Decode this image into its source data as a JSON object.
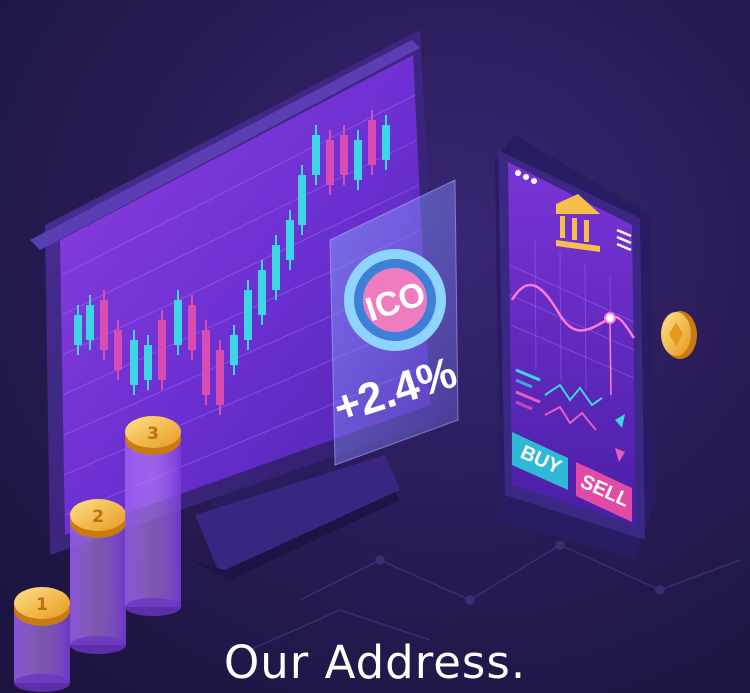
{
  "illustration": {
    "ico_badge": {
      "label": "ICO",
      "change": "+2.4%"
    },
    "phone": {
      "buy_label": "BUY",
      "sell_label": "SELL"
    },
    "coins": [
      "1",
      "2",
      "3"
    ]
  },
  "caption": {
    "text": "Our Address."
  },
  "colors": {
    "background": "#24184a",
    "screen": "#6a2fd0",
    "candle_cyan": "#3ed6e6",
    "candle_pink": "#d94cb3",
    "coin_gold": "#f5b942",
    "buy_button": "#2fb8d8",
    "sell_button": "#e24aa6"
  }
}
